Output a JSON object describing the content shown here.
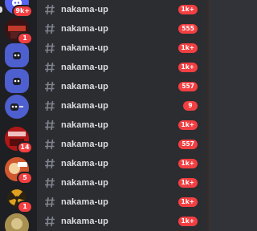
{
  "servers": [
    {
      "badge": "9k+",
      "bg": "#5865f2"
    },
    {
      "badge": "1",
      "bg": "#3a1414"
    },
    {
      "badge": "",
      "bg": "#4e5fd0"
    },
    {
      "badge": "",
      "bg": "#4e5fd0"
    },
    {
      "badge": "",
      "bg": "#4e5fd0"
    },
    {
      "badge": "",
      "bg": "#4e5fd0"
    },
    {
      "badge": "14",
      "bg": "#b01818"
    },
    {
      "badge": "5",
      "bg": "#c0432a"
    },
    {
      "badge": "1",
      "bg": "#b8862a"
    },
    {
      "badge": "",
      "bg": "#8a7b4a"
    }
  ],
  "channels": [
    {
      "name": "nakama-up",
      "badge": "1k+"
    },
    {
      "name": "nakama-up",
      "badge": "555"
    },
    {
      "name": "nakama-up",
      "badge": "1k+"
    },
    {
      "name": "nakama-up",
      "badge": "1k+"
    },
    {
      "name": "nakama-up",
      "badge": "557"
    },
    {
      "name": "nakama-up",
      "badge": "9"
    },
    {
      "name": "nakama-up",
      "badge": "1k+"
    },
    {
      "name": "nakama-up",
      "badge": "557"
    },
    {
      "name": "nakama-up",
      "badge": "1k+"
    },
    {
      "name": "nakama-up",
      "badge": "1k+"
    },
    {
      "name": "nakama-up",
      "badge": "1k+"
    },
    {
      "name": "nakama-up",
      "badge": "1k+"
    }
  ]
}
